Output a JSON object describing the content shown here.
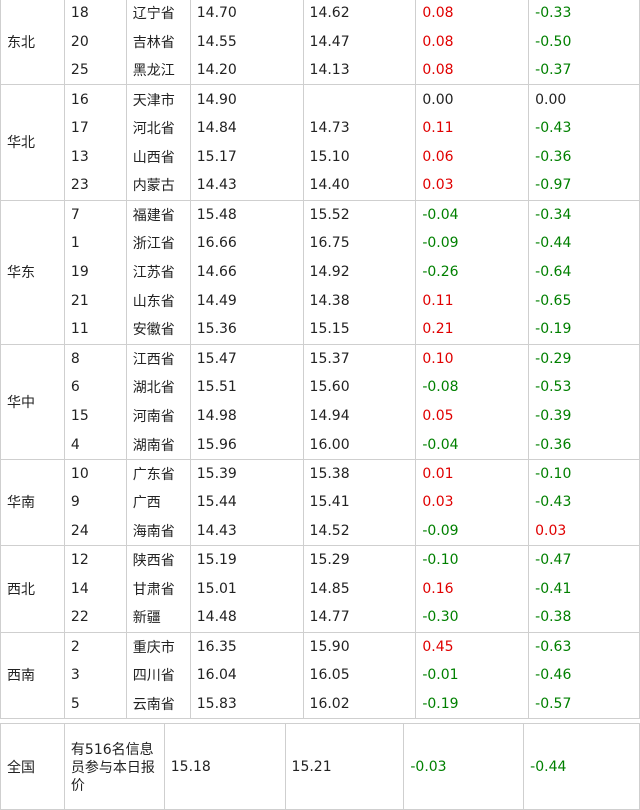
{
  "regions": [
    {
      "name": "东北",
      "rows": [
        {
          "rank": "18",
          "province": "辽宁省",
          "v1": "14.70",
          "v2": "14.62",
          "d1": "0.08",
          "d1c": "red",
          "d2": "-0.33",
          "d2c": "green"
        },
        {
          "rank": "20",
          "province": "吉林省",
          "v1": "14.55",
          "v2": "14.47",
          "d1": "0.08",
          "d1c": "red",
          "d2": "-0.50",
          "d2c": "green"
        },
        {
          "rank": "25",
          "province": "黑龙江",
          "v1": "14.20",
          "v2": "14.13",
          "d1": "0.08",
          "d1c": "red",
          "d2": "-0.37",
          "d2c": "green"
        }
      ]
    },
    {
      "name": "华北",
      "rows": [
        {
          "rank": "16",
          "province": "天津市",
          "v1": "14.90",
          "v2": "",
          "d1": "0.00",
          "d1c": "plain",
          "d2": "0.00",
          "d2c": "plain"
        },
        {
          "rank": "17",
          "province": "河北省",
          "v1": "14.84",
          "v2": "14.73",
          "d1": "0.11",
          "d1c": "red",
          "d2": "-0.43",
          "d2c": "green"
        },
        {
          "rank": "13",
          "province": "山西省",
          "v1": "15.17",
          "v2": "15.10",
          "d1": "0.06",
          "d1c": "red",
          "d2": "-0.36",
          "d2c": "green"
        },
        {
          "rank": "23",
          "province": "内蒙古",
          "v1": "14.43",
          "v2": "14.40",
          "d1": "0.03",
          "d1c": "red",
          "d2": "-0.97",
          "d2c": "green"
        }
      ]
    },
    {
      "name": "华东",
      "rows": [
        {
          "rank": "7",
          "province": "福建省",
          "v1": "15.48",
          "v2": "15.52",
          "d1": "-0.04",
          "d1c": "green",
          "d2": "-0.34",
          "d2c": "green"
        },
        {
          "rank": "1",
          "province": "浙江省",
          "v1": "16.66",
          "v2": "16.75",
          "d1": "-0.09",
          "d1c": "green",
          "d2": "-0.44",
          "d2c": "green"
        },
        {
          "rank": "19",
          "province": "江苏省",
          "v1": "14.66",
          "v2": "14.92",
          "d1": "-0.26",
          "d1c": "green",
          "d2": "-0.64",
          "d2c": "green"
        },
        {
          "rank": "21",
          "province": "山东省",
          "v1": "14.49",
          "v2": "14.38",
          "d1": "0.11",
          "d1c": "red",
          "d2": "-0.65",
          "d2c": "green"
        },
        {
          "rank": "11",
          "province": "安徽省",
          "v1": "15.36",
          "v2": "15.15",
          "d1": "0.21",
          "d1c": "red",
          "d2": "-0.19",
          "d2c": "green"
        }
      ]
    },
    {
      "name": "华中",
      "rows": [
        {
          "rank": "8",
          "province": "江西省",
          "v1": "15.47",
          "v2": "15.37",
          "d1": "0.10",
          "d1c": "red",
          "d2": "-0.29",
          "d2c": "green"
        },
        {
          "rank": "6",
          "province": "湖北省",
          "v1": "15.51",
          "v2": "15.60",
          "d1": "-0.08",
          "d1c": "green",
          "d2": "-0.53",
          "d2c": "green"
        },
        {
          "rank": "15",
          "province": "河南省",
          "v1": "14.98",
          "v2": "14.94",
          "d1": "0.05",
          "d1c": "red",
          "d2": "-0.39",
          "d2c": "green"
        },
        {
          "rank": "4",
          "province": "湖南省",
          "v1": "15.96",
          "v2": "16.00",
          "d1": "-0.04",
          "d1c": "green",
          "d2": "-0.36",
          "d2c": "green"
        }
      ]
    },
    {
      "name": "华南",
      "rows": [
        {
          "rank": "10",
          "province": "广东省",
          "v1": "15.39",
          "v2": "15.38",
          "d1": "0.01",
          "d1c": "red",
          "d2": "-0.10",
          "d2c": "green"
        },
        {
          "rank": "9",
          "province": "广西",
          "v1": "15.44",
          "v2": "15.41",
          "d1": "0.03",
          "d1c": "red",
          "d2": "-0.43",
          "d2c": "green"
        },
        {
          "rank": "24",
          "province": "海南省",
          "v1": "14.43",
          "v2": "14.52",
          "d1": "-0.09",
          "d1c": "green",
          "d2": "0.03",
          "d2c": "red"
        }
      ]
    },
    {
      "name": "西北",
      "rows": [
        {
          "rank": "12",
          "province": "陕西省",
          "v1": "15.19",
          "v2": "15.29",
          "d1": "-0.10",
          "d1c": "green",
          "d2": "-0.47",
          "d2c": "green"
        },
        {
          "rank": "14",
          "province": "甘肃省",
          "v1": "15.01",
          "v2": "14.85",
          "d1": "0.16",
          "d1c": "red",
          "d2": "-0.41",
          "d2c": "green"
        },
        {
          "rank": "22",
          "province": "新疆",
          "v1": "14.48",
          "v2": "14.77",
          "d1": "-0.30",
          "d1c": "green",
          "d2": "-0.38",
          "d2c": "green"
        }
      ]
    },
    {
      "name": "西南",
      "rows": [
        {
          "rank": "2",
          "province": "重庆市",
          "v1": "16.35",
          "v2": "15.90",
          "d1": "0.45",
          "d1c": "red",
          "d2": "-0.63",
          "d2c": "green"
        },
        {
          "rank": "3",
          "province": "四川省",
          "v1": "16.04",
          "v2": "16.05",
          "d1": "-0.01",
          "d1c": "green",
          "d2": "-0.46",
          "d2c": "green"
        },
        {
          "rank": "5",
          "province": "云南省",
          "v1": "15.83",
          "v2": "16.02",
          "d1": "-0.19",
          "d1c": "green",
          "d2": "-0.57",
          "d2c": "green"
        }
      ]
    }
  ],
  "national": {
    "name": "全国",
    "note": "有516名信息员参与本日报价",
    "v1": "15.18",
    "v2": "15.21",
    "d1": "-0.03",
    "d1c": "green",
    "d2": "-0.44",
    "d2c": "green"
  },
  "colors": {
    "red": "#e00000",
    "green": "#008000",
    "border": "#cfcfcf"
  }
}
